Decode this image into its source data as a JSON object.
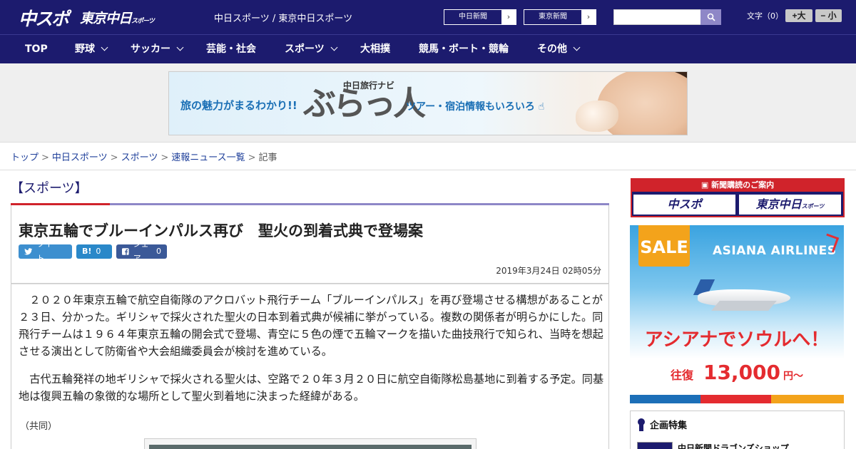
{
  "header": {
    "logo_chuspo": "中スポ",
    "logo_tokyo": "東京中日",
    "logo_tokyo_suffix": "スポーツ",
    "site_links": "中日スポーツ / 東京中日スポーツ",
    "paper_buttons": [
      {
        "label": "中日新聞"
      },
      {
        "label": "東京新聞"
      }
    ],
    "search": {
      "value": "",
      "placeholder": ""
    },
    "font_size": {
      "label": "文字（0）",
      "increase": "+大",
      "decrease": "− 小"
    }
  },
  "nav": {
    "items": [
      {
        "label": "TOP",
        "has_dropdown": false
      },
      {
        "label": "野球",
        "has_dropdown": true
      },
      {
        "label": "サッカー",
        "has_dropdown": true
      },
      {
        "label": "芸能・社会",
        "has_dropdown": false
      },
      {
        "label": "スポーツ",
        "has_dropdown": true
      },
      {
        "label": "大相撲",
        "has_dropdown": false
      },
      {
        "label": "競馬・ボート・競輪",
        "has_dropdown": false
      },
      {
        "label": "その他",
        "has_dropdown": true
      }
    ]
  },
  "banner": {
    "left_text": "旅の魅力がまるわかり!!",
    "sub": "中日旅行ナビ",
    "logo": "ぶらっ人",
    "right_text": "ツアー・宿泊情報もいろいろ"
  },
  "breadcrumb": {
    "items": [
      "トップ",
      "中日スポーツ",
      "スポーツ",
      "速報ニュース一覧"
    ],
    "current": "記事"
  },
  "article": {
    "category": "【スポーツ】",
    "headline": "東京五輪でブルーインパルス再び　聖火の到着式典で登場案",
    "share": {
      "tweet": "ツイート",
      "hatena_count": "0",
      "facebook": "シェア",
      "facebook_count": "0"
    },
    "date": "2019年3月24日 02時05分",
    "paragraphs": [
      "　２０２０年東京五輪で航空自衛隊のアクロバット飛行チーム「ブルーインパルス」を再び登場させる構想があることが２３日、分かった。ギリシャで採火された聖火の日本到着式典が候補に挙がっている。複数の関係者が明らかにした。同飛行チームは１９６４年東京五輪の開会式で登場、青空に５色の煙で五輪マークを描いた曲技飛行で知られ、当時を想起させる演出として防衛省や大会組織委員会が検討を進めている。",
      "　古代五輪発祥の地ギリシャで採火される聖火は、空路で２０年３月２０日に航空自衛隊松島基地に到着する予定。同基地は復興五輪の象徴的な場所として聖火到着地に決まった経緯がある。"
    ],
    "credit": "（共同）"
  },
  "sidebar": {
    "subscribe_head": "新聞購読のご案内",
    "subscribe_left": "中スポ",
    "subscribe_right": "東京中日",
    "subscribe_right_suffix": "スポーツ",
    "ad": {
      "sale": "SALE",
      "brand": "ASIANA AIRLINES",
      "title": "アシアナでソウルへ！",
      "fare_label": "往復",
      "fare": "13,000",
      "fare_unit": "円〜"
    },
    "feature_title": "企画特集",
    "feature_item": "中日新聞ドラゴンズショップ"
  },
  "colors": {
    "brand_navy": "#1c1b6e",
    "accent_red": "#d0232b",
    "accent_purple": "#8e87c7",
    "link_blue": "#1e3f9a"
  }
}
